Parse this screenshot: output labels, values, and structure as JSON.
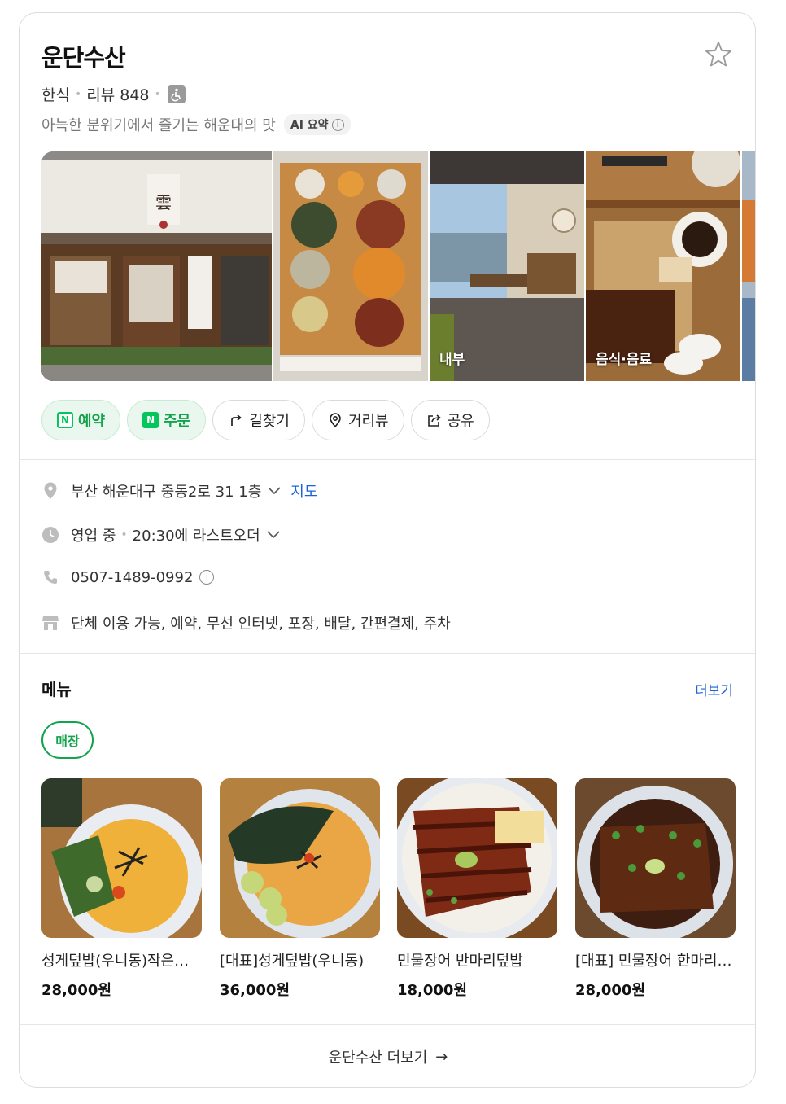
{
  "place": {
    "name": "운단수산",
    "category": "한식",
    "review_label": "리뷰 848",
    "summary": "아늑한 분위기에서 즐기는 해운대의 맛",
    "ai_label": "AI 요약",
    "info_glyph": "i"
  },
  "photos": [
    {
      "label": ""
    },
    {
      "label": ""
    },
    {
      "label": "내부"
    },
    {
      "label": "음식·음료"
    }
  ],
  "actions": {
    "reserve": "예약",
    "order": "주문",
    "directions": "길찾기",
    "street_view": "거리뷰",
    "share": "공유",
    "n_glyph": "N"
  },
  "info": {
    "address": "부산 해운대구 중동2로 31 1층",
    "map_link": "지도",
    "status": "영업 중",
    "last_order": "20:30에 라스트오더",
    "phone": "0507-1489-0992",
    "amenities": "단체 이용 가능, 예약, 무선 인터넷, 포장, 배달, 간편결제, 주차"
  },
  "menu": {
    "title": "메뉴",
    "more": "더보기",
    "filter_chip": "매장",
    "items": [
      {
        "name": "성게덮밥(우니동)작은사이즈",
        "price": "28,000원"
      },
      {
        "name": "[대표]성게덮밥(우니동)",
        "price": "36,000원"
      },
      {
        "name": "민물장어 반마리덮밥",
        "price": "18,000원"
      },
      {
        "name": "[대표] 민물장어 한마리덮밥",
        "price": "28,000원"
      }
    ]
  },
  "footer": {
    "label": "운단수산 더보기",
    "arrow": "→"
  },
  "colors": {
    "accent_green": "#03c75a",
    "link_blue": "#1a62d6"
  }
}
